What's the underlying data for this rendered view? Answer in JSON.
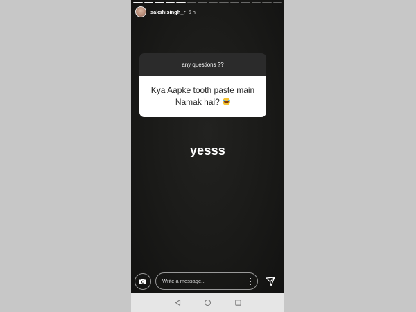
{
  "story": {
    "progress_segments_total": 14,
    "progress_segments_done": 5,
    "user": {
      "username": "sakshisingh_r",
      "time_ago": "6 h"
    },
    "question_sticker": {
      "prompt": "any questions ??",
      "answer_line1": "Kya Aapke tooth paste main",
      "answer_line2": "Namak hai?",
      "emoji": "face-with-tears-of-joy"
    },
    "reply_text": "yesss"
  },
  "message_bar": {
    "placeholder": "Write a message..."
  },
  "nav": {
    "buttons": [
      "back",
      "home",
      "recents"
    ]
  },
  "colors": {
    "background": "#1a1a18",
    "sticker_header": "#2b2b2b",
    "sticker_body": "#ffffff",
    "page_border": "#c7c7c7",
    "navbar": "#e6e6e6"
  }
}
